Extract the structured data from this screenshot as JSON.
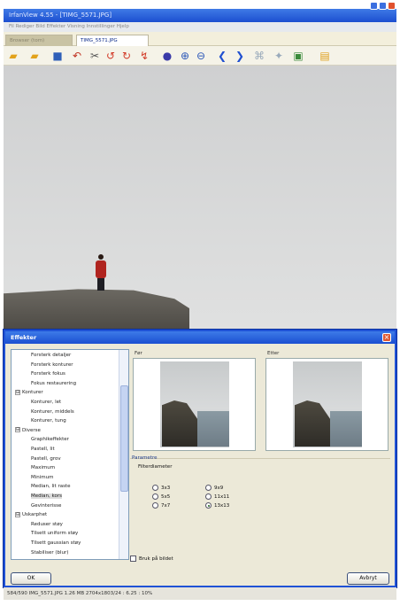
{
  "window": {
    "title": "IrfanView 4.55 - [TIMG_5571.JPG]"
  },
  "menu": {
    "text": "Fil  Rediger  Bild  Effekter  Visning  Innstillinger  Hjelp"
  },
  "tabs": [
    {
      "label": "Browser (tom)"
    },
    {
      "label": "TIMG_5571.JPG"
    }
  ],
  "toolbar_icons": [
    "open-folder-icon",
    "open-icon",
    "save-icon",
    "undo-icon",
    "cut-icon",
    "rotate-left-icon",
    "rotate-right-icon",
    "resize-icon",
    "color-icon",
    "zoom-in-icon",
    "zoom-out-icon",
    "prev-icon",
    "next-icon",
    "slideshow-icon",
    "effects-icon",
    "settings-icon",
    "info-icon"
  ],
  "dialog": {
    "title": "Effekter",
    "close_glyph": "×",
    "before_label": "Før",
    "after_label": "Etter",
    "params_title": "Parametre",
    "filter_label": "Filterdiameter",
    "radios_left": [
      {
        "label": "3x3",
        "checked": false
      },
      {
        "label": "5x5",
        "checked": false
      },
      {
        "label": "7x7",
        "checked": false
      }
    ],
    "radios_right": [
      {
        "label": "9x9",
        "checked": false
      },
      {
        "label": "11x11",
        "checked": false
      },
      {
        "label": "13x13",
        "checked": true
      }
    ],
    "apply_checkbox": "Bruk på bildet",
    "ok": "OK",
    "cancel": "Avbryt",
    "tree": [
      {
        "label": "Forsterk detaljer",
        "level": 2
      },
      {
        "label": "Forsterk konturer",
        "level": 2
      },
      {
        "label": "Forsterk fokus",
        "level": 2
      },
      {
        "label": "Fokus restaurering",
        "level": 2
      },
      {
        "label": "Konturer",
        "level": 1,
        "expander": "⊟"
      },
      {
        "label": "Konturer, let",
        "level": 2
      },
      {
        "label": "Konturer, middels",
        "level": 2
      },
      {
        "label": "Konturer, tung",
        "level": 2
      },
      {
        "label": "Diverse",
        "level": 1,
        "expander": "⊟"
      },
      {
        "label": "Graphikeffekter",
        "level": 2
      },
      {
        "label": "Pastell, lit",
        "level": 2
      },
      {
        "label": "Pastell, grov",
        "level": 2
      },
      {
        "label": "Maximum",
        "level": 2
      },
      {
        "label": "Minimum",
        "level": 2
      },
      {
        "label": "Median, lit raste",
        "level": 2
      },
      {
        "label": "Median, kors",
        "level": 2,
        "selected": true
      },
      {
        "label": "Gevinterisse",
        "level": 2
      },
      {
        "label": "Uskarphet",
        "level": 1,
        "expander": "⊟"
      },
      {
        "label": "Reduser støy",
        "level": 2
      },
      {
        "label": "Tilsett uniform støy",
        "level": 2
      },
      {
        "label": "Tilsett gaussian støy",
        "level": 2
      },
      {
        "label": "Stabiliser (blur)",
        "level": 2
      }
    ]
  },
  "status": {
    "text": "584/590    IMG_5571.JPG    1.26 MB    2704x1803/24 : 6.25 : 10%"
  }
}
